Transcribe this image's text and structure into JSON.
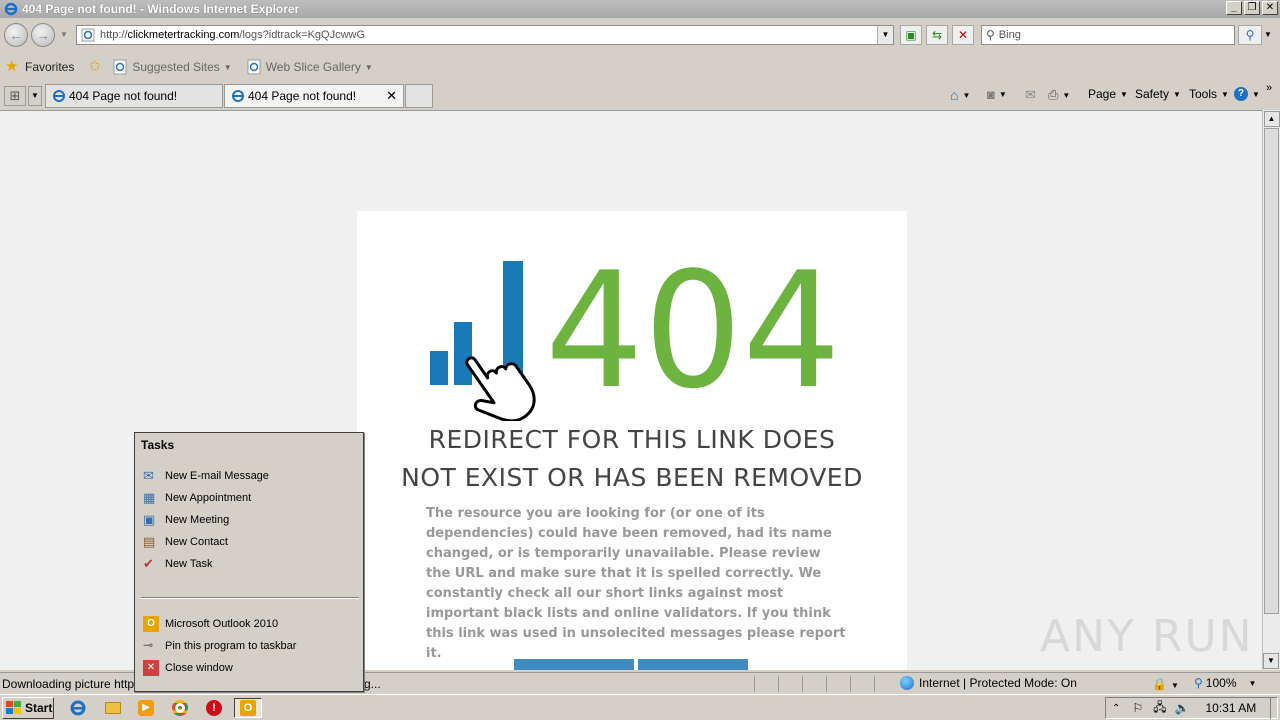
{
  "window": {
    "title": "404 Page not found! - Windows Internet Explorer"
  },
  "address": {
    "prefix": "http://",
    "domain": "clickmetertracking.com",
    "path": "/logs?idtrack=KgQJcwwG"
  },
  "search": {
    "placeholder": "Bing"
  },
  "favorites_bar": {
    "favorites": "Favorites",
    "suggested": "Suggested Sites",
    "slice": "Web Slice Gallery"
  },
  "tabs": [
    {
      "label": "404 Page not found!"
    },
    {
      "label": "404 Page not found!"
    }
  ],
  "commands": {
    "page": "Page",
    "safety": "Safety",
    "tools": "Tools"
  },
  "page": {
    "big_number": "404",
    "title_line1": "REDIRECT FOR THIS LINK DOES",
    "title_line2": "NOT EXIST OR HAS BEEN REMOVED",
    "description": "The resource you are looking for (or one of its dependencies) could have been removed, had its name changed, or is temporarily unavailable. Please review the URL and make sure that it is spelled correctly. We constantly check all our short links against most important black lists and online validators. If you think this link was used in unsolecited messages please report it."
  },
  "watermark": "ANY RUN",
  "status": {
    "text": "Downloading picture http://",
    "text_tail": "g...",
    "zone": "Internet | Protected Mode: On",
    "zoom": "100%"
  },
  "tasks_menu": {
    "header": "Tasks",
    "items": [
      "New E-mail Message",
      "New Appointment",
      "New Meeting",
      "New Contact",
      "New Task"
    ],
    "app_items": [
      "Microsoft Outlook 2010",
      "Pin this program to taskbar",
      "Close window"
    ]
  },
  "taskbar": {
    "start": "Start",
    "clock": "10:31 AM"
  },
  "colors": {
    "green": "#6db33f",
    "blue": "#1a7ab8"
  }
}
